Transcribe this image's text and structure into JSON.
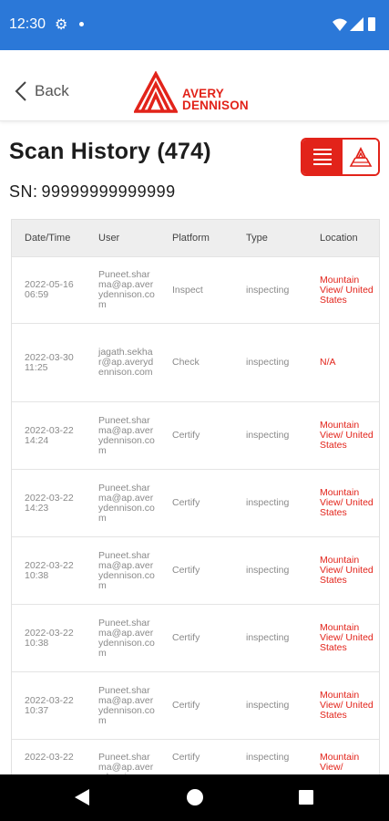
{
  "status_bar": {
    "time": "12:30"
  },
  "header": {
    "back_label": "Back",
    "logo_line1": "AVERY",
    "logo_line2": "DENNISON"
  },
  "page": {
    "title": "Scan History (474)",
    "sn_label": "SN:",
    "sn_value": "99999999999999"
  },
  "colors": {
    "accent": "#e2231a",
    "status_bar": "#2b78d8"
  },
  "table": {
    "headers": {
      "date": "Date/Time",
      "user": "User",
      "platform": "Platform",
      "type": "Type",
      "location": "Location"
    },
    "rows": [
      {
        "date": "2022-05-16 06:59",
        "user": "Puneet.sharma@ap.averydennison.com",
        "platform": "Inspect",
        "type": "inspecting",
        "location": "Mountain View/ United States"
      },
      {
        "date": "2022-03-30 11:25",
        "user": "jagath.sekhar@ap.averydennison.com",
        "platform": "Check",
        "type": "inspecting",
        "location": "N/A"
      },
      {
        "date": "2022-03-22 14:24",
        "user": "Puneet.sharma@ap.averydennison.com",
        "platform": "Certify",
        "type": "inspecting",
        "location": "Mountain View/ United States"
      },
      {
        "date": "2022-03-22 14:23",
        "user": "Puneet.sharma@ap.averydennison.com",
        "platform": "Certify",
        "type": "inspecting",
        "location": "Mountain View/ United States"
      },
      {
        "date": "2022-03-22 10:38",
        "user": "Puneet.sharma@ap.averydennison.com",
        "platform": "Certify",
        "type": "inspecting",
        "location": "Mountain View/ United States"
      },
      {
        "date": "2022-03-22 10:38",
        "user": "Puneet.sharma@ap.averydennison.com",
        "platform": "Certify",
        "type": "inspecting",
        "location": "Mountain View/ United States"
      },
      {
        "date": "2022-03-22 10:37",
        "user": "Puneet.sharma@ap.averydennison.com",
        "platform": "Certify",
        "type": "inspecting",
        "location": "Mountain View/ United States"
      },
      {
        "date": "2022-03-22",
        "user": "Puneet.sharma@ap.averydennison.com",
        "platform": "Certify",
        "type": "inspecting",
        "location": "Mountain View/"
      }
    ]
  },
  "icons": {
    "gear": "gear-icon",
    "list_view": "list-view-icon",
    "map_view": "map-view-icon"
  }
}
